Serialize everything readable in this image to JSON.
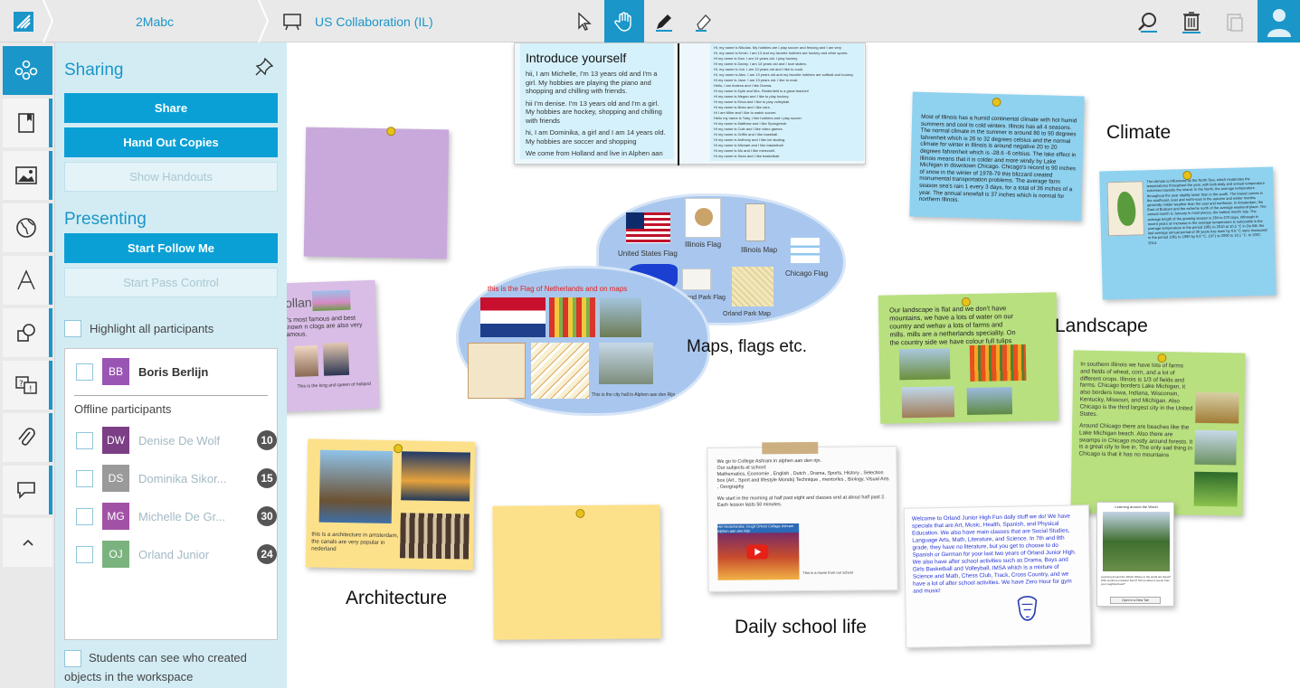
{
  "breadcrumb": {
    "group": "2Mabc",
    "workspace": "US Collaboration (IL)"
  },
  "toolbar": {
    "tools": [
      "pointer-tool",
      "hand-tool",
      "pen-tool",
      "eraser-tool"
    ],
    "active_tool": "hand-tool",
    "right": [
      "search-icon",
      "trash-icon",
      "paste-icon",
      "user-avatar"
    ]
  },
  "colors": {
    "accent": "#1a96c8",
    "panel_bg": "#d3ecf4",
    "button": "#0aa0d6"
  },
  "rail": {
    "items": [
      "participants-icon",
      "book-icon",
      "image-icon",
      "globe-icon",
      "text-icon",
      "shapes-icon",
      "quiz-icon",
      "attachment-icon",
      "comment-icon",
      "collapse-up-icon"
    ]
  },
  "sharing": {
    "heading": "Sharing",
    "share": "Share",
    "hand_out": "Hand Out Copies",
    "show_handouts": "Show Handouts"
  },
  "presenting": {
    "heading": "Presenting",
    "start_follow": "Start Follow Me",
    "start_pass": "Start Pass Control"
  },
  "highlight_label": "Highlight all participants",
  "participants": {
    "online": [
      {
        "initials": "BB",
        "name": "Boris Berlijn",
        "color": "#9a55b4"
      }
    ],
    "offline_heading": "Offline participants",
    "offline": [
      {
        "initials": "DW",
        "name": "Denise De Wolf",
        "count": "10",
        "color": "#7c3f86"
      },
      {
        "initials": "DS",
        "name": "Dominika Sikor...",
        "count": "15",
        "color": "#9a9a9a"
      },
      {
        "initials": "MG",
        "name": "Michelle De Gr...",
        "count": "30",
        "color": "#a252a6"
      },
      {
        "initials": "OJ",
        "name": "Orland Junior",
        "count": "24",
        "color": "#7bb37f"
      }
    ]
  },
  "students_option": "Students can see who created objects in the workspace",
  "canvas": {
    "labels": {
      "climate": "Climate",
      "landscape": "Landscape",
      "maps": "Maps, flags etc.",
      "architecture": "Architecture",
      "daily": "Daily school life"
    },
    "intro": {
      "title": "Introduce yourself",
      "p1": "hii, I am Michelle, I'm 13 years old and I'm a girl. My hobbies are playing the piano and shopping and chilling with friends.",
      "p2": "hii I'm denise. I'm 13 years old and I'm a girl. My hobbies are hockey, shopping and chilling with friends",
      "p3": "hi, I am Dominika, a girl and I am 14 years old. My hobbies are soccer and shopping",
      "p4": "We come from Holland and live in Alphen aan den Rijn and in ter aar",
      "right_lines": [
        "Hi, my name is Nikolas. My hobbies are I play soccer and fencing and I am very",
        "Hi, my name is Kevin. I am 13 and my favorite hobbies are hockey and other sports.",
        "Hi my name is Dan. I am 14 years old. I play hockey.",
        "Hi my name is Danny. I am 13 years old and I love skates.",
        "Hi, my name is Jon. I am 13 years old and I like to cook.",
        "Hi, my name is Alex. I am 13 years old and my favorite hobbies are softball and hockey.",
        "Hi my name is Jane. I am 13 years old. I like to read.",
        "Hello, I am Andrea and I like Drama.",
        "Hi my name is Kylie and Mrs. Reidenfeld is a great teacher!",
        "Hi my name is Megan and I like to play hockey.",
        "Hi my name is Erica and I like to play volleyball.",
        "Hi my name is Brian and I like cars.",
        "Hi I am Mike and I like to watch soccer.",
        "Hello my name is Toby, I like hobbies and I play soccer.",
        "Hi my name is Matthew and I like Spongebob.",
        "Hi my name is Cole and I like video games.",
        "Hi my name is Griffin and I like baseball.",
        "Hi my name is Anthony and I like ice skating.",
        "Hi my name is Michael and I like basketball.",
        "Hi my name is Mo and I like minecraft.",
        "Hi my name is Sean and I like basketball."
      ]
    },
    "holland": {
      "title": "holland",
      "text": "y's most famous and best known n clogs are also very famous.",
      "caption": "This is the king and queen of holland"
    },
    "map_items": [
      {
        "label": "United States Flag"
      },
      {
        "label": "Illinois Flag"
      },
      {
        "label": "Illinois Map"
      },
      {
        "label": "Chicago Flag"
      },
      {
        "label": "Orland Park Flag"
      },
      {
        "label": "Orland Park Map"
      }
    ],
    "nl_caption": "this is the Flag of Netherlands and on maps",
    "city_hall_caption": "This is the city hall in Alphen aan den Rijn",
    "climate_text": "Most of Illinois has a humid continental climate with hot humid summers and cool to cold winters. Illinois has all 4 seasons. The normal climate in the summer is around 80 to 90 degrees fahrenheit which is 26 to 32 degrees celsius and the normal climate for winter in Illinois is around negative 20 to 20 degrees fahrenheit which is -28.6 -6 celsius. The lake effect in Illinois means that it is colder and more windy by Lake Michigan in downtown Chicago. Chicago's record is 90 inches of snow in the winter of 1978-79 this blizzard created monumental transportation problems. The average farm season sea's rain 1 every 3 days, for a total of 36 inches of a year. The annual snowfall is 37 inches which is normal for northern Illinois.",
    "climate_nl_text": "The climate is influenced by the North Sea, which moderates the temperatures throughout the year, with both daily and annual temperature extremes towards the inland. In the North, the average temperature throughout the year slightly lower than in the south. The lowest comes in the southeast, east and north-east in the autumn and winter months generally milder weather than the east and northeast. In Amsterdam, the East of Brabant and the extreme north of the average weekend place. The annual month is January in most places, the hottest month July. The average length of the growing season is 284 to 270 days. Although in recent years an increase in the average temperature is noticeable is the average temperature in the period 1981 to 2010 at 10.5 °C in De Bilt; the last average annual period of 30 years has risen by 0.6 °C were measured in the period 1961 to 1990 by 9.8 °C, 1971 to 2000 to 10.1 °C. In 2007, 2014.",
    "landscape_text": "Our landscape is flat and we don't have mountains, we have a lots of water on our country and wehav a lots of farms and mills. mills are a netherlands speciality. On the country side we have colour full tulips",
    "landscape_il_text1": "In southern Illinois we have lots of farms and fields of wheat, corn, and a lot of different crops. Illinois is 1/3 of fields and farms. Chicago borders Lake Michigan, it also borders Iowa, Indiana, Wisconsin, Kentucky, Missouri, and Michigan. Also Chicago is the third largest city in the United States.",
    "landscape_il_text2": "Around Chicago there are beaches like the Lake Michigan beach. Also there are swamps in Chicago mostly around forests. It is a great city to live in. The only sad thing in Chicago is that it has no mountains",
    "arch_text": "this is a architecture in amsterdam, the canals are very popular in nederland",
    "school_text": [
      "We go to College Ashram in alphen aan den rijn.",
      "Our subjects at school:",
      "Mathematics, Economie , English , Dutch , Drama, Sports, History , Selection box (Art , Sport and lifestyle Monds) Technique , mentorles , Biology, Visual Arts , Geography",
      "We start in the morning at half past eight and classes end at about half past 2. Each lesson lasts 50 minutes."
    ],
    "video_title": "Het Nederlandse Jeugd Orkest Collage Ashram Alphen aan den Rijn",
    "video_caption": "This is a movie from our school",
    "orland_text": "Welcome to Orland Junior High Fun daily stuff we do! We have specials that are Art, Music, Health, Spanish, and Physical Education. We also have main classes that are Social Studies, Language Arts, Math, Literature, and Science. In 7th and 8th grade, they have no literature, but you get to choose to do Spanish or German for your last two years of Orland Junior High. We also have after school activities such as Drama, Boys and Girls Basketball and Volleyball, IMSA which is a mixture of Science and Math, Chess Club, Track, Cross Country, and we have a lot of after school activities. We have Zero Hour for gym and music!",
    "world_card": {
      "title": "Learning around the World",
      "caption": "Learning around the World: Where in the world are these? Who would you answer them? Tell us about a scene from your neighborhood?",
      "button": "Open in a New Tab"
    }
  }
}
